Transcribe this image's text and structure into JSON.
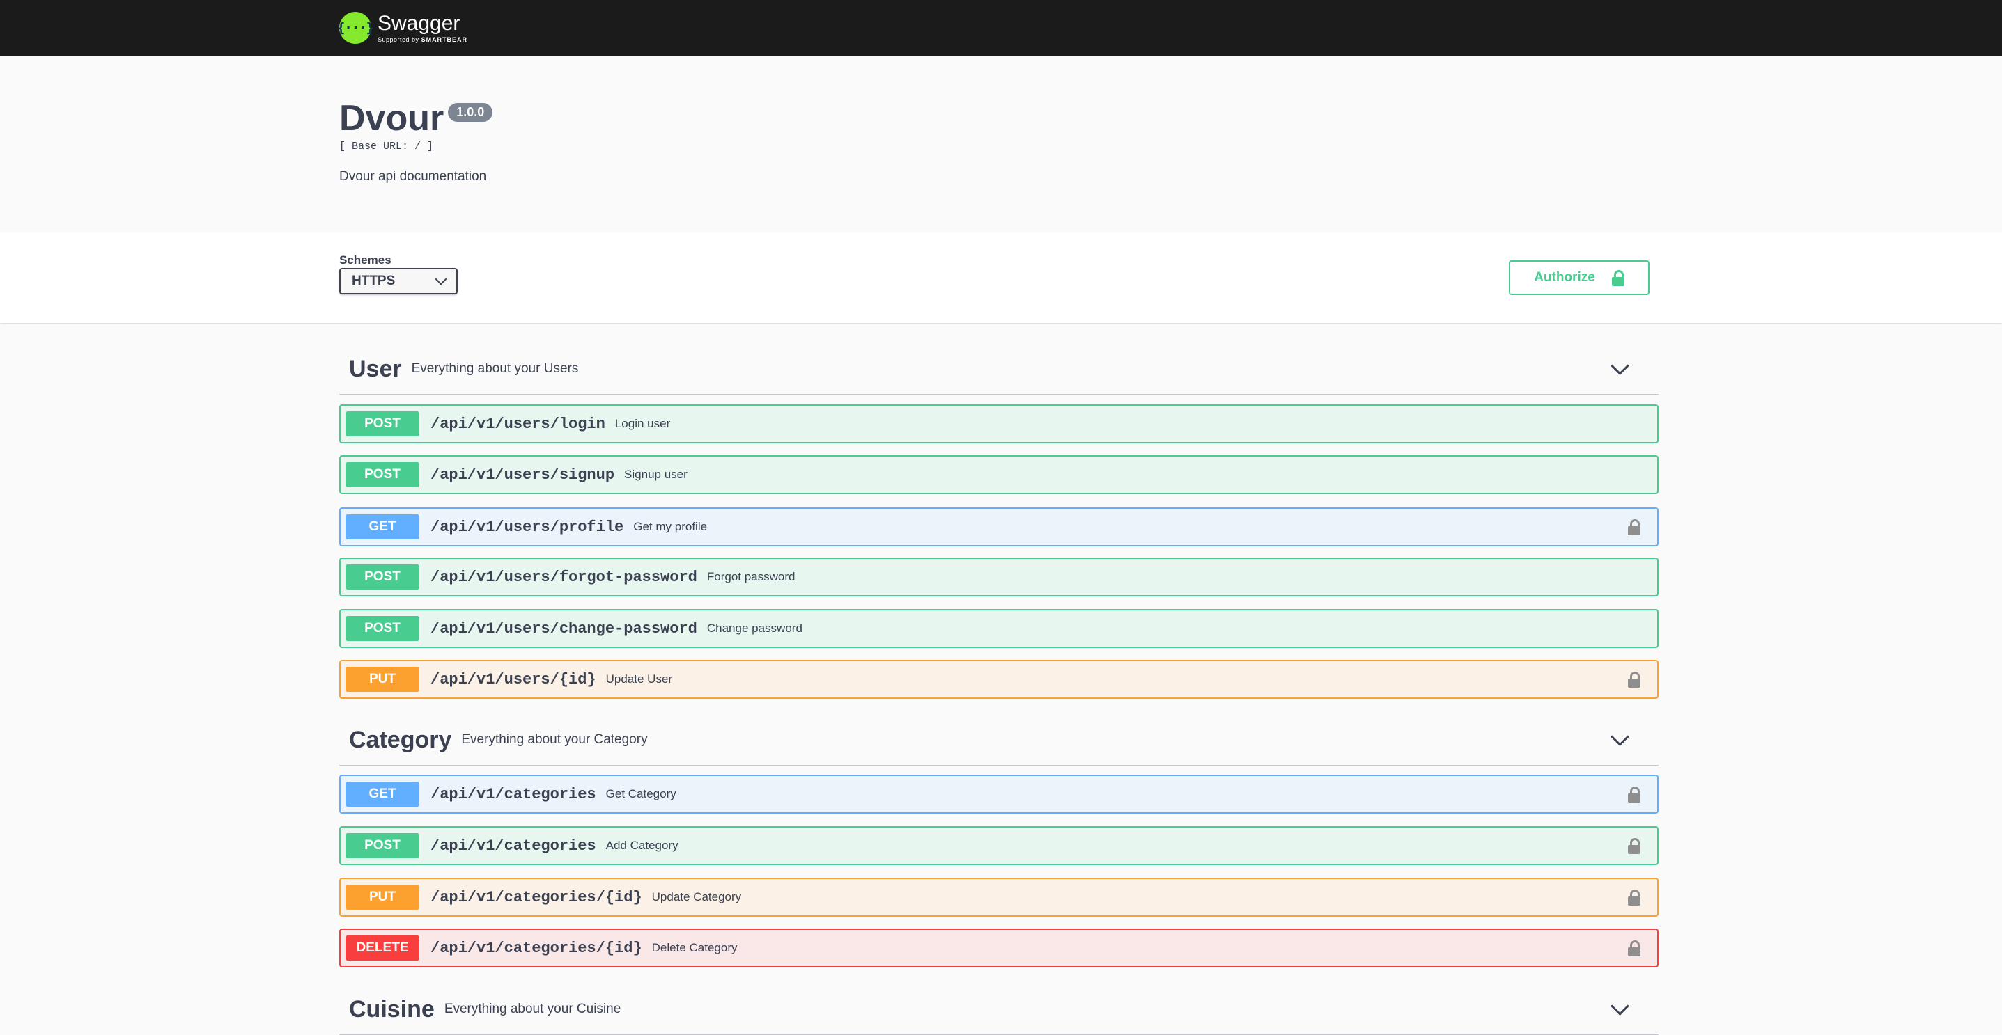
{
  "brand": {
    "name": "Swagger",
    "mark": "{···}",
    "supported_prefix": "Supported by",
    "supported_by": "SMARTBEAR"
  },
  "info": {
    "title": "Dvour",
    "version": "1.0.0",
    "base_url": "[ Base URL: / ]",
    "description": "Dvour api documentation"
  },
  "schemes": {
    "label": "Schemes",
    "selected": "HTTPS"
  },
  "authorize": {
    "label": "Authorize"
  },
  "tags": [
    {
      "name": "User",
      "description": "Everything about your Users",
      "operations": [
        {
          "method": "POST",
          "path": "/api/v1/users/login",
          "summary": "Login user",
          "locked": false
        },
        {
          "method": "POST",
          "path": "/api/v1/users/signup",
          "summary": "Signup user",
          "locked": false
        },
        {
          "method": "GET",
          "path": "/api/v1/users/profile",
          "summary": "Get my profile",
          "locked": true
        },
        {
          "method": "POST",
          "path": "/api/v1/users/forgot-password",
          "summary": "Forgot password",
          "locked": false
        },
        {
          "method": "POST",
          "path": "/api/v1/users/change-password",
          "summary": "Change password",
          "locked": false
        },
        {
          "method": "PUT",
          "path": "/api/v1/users/{id}",
          "summary": "Update User",
          "locked": true
        }
      ]
    },
    {
      "name": "Category",
      "description": "Everything about your Category",
      "operations": [
        {
          "method": "GET",
          "path": "/api/v1/categories",
          "summary": "Get Category",
          "locked": true
        },
        {
          "method": "POST",
          "path": "/api/v1/categories",
          "summary": "Add Category",
          "locked": true
        },
        {
          "method": "PUT",
          "path": "/api/v1/categories/{id}",
          "summary": "Update Category",
          "locked": true
        },
        {
          "method": "DELETE",
          "path": "/api/v1/categories/{id}",
          "summary": "Delete Category",
          "locked": true
        }
      ]
    },
    {
      "name": "Cuisine",
      "description": "Everything about your Cuisine",
      "operations": []
    }
  ],
  "colors": {
    "post": "#49cc90",
    "get": "#61affe",
    "put": "#fca130",
    "delete": "#f93e3e",
    "topbar": "#1b1b1b",
    "brand_green": "#85ea2d"
  }
}
